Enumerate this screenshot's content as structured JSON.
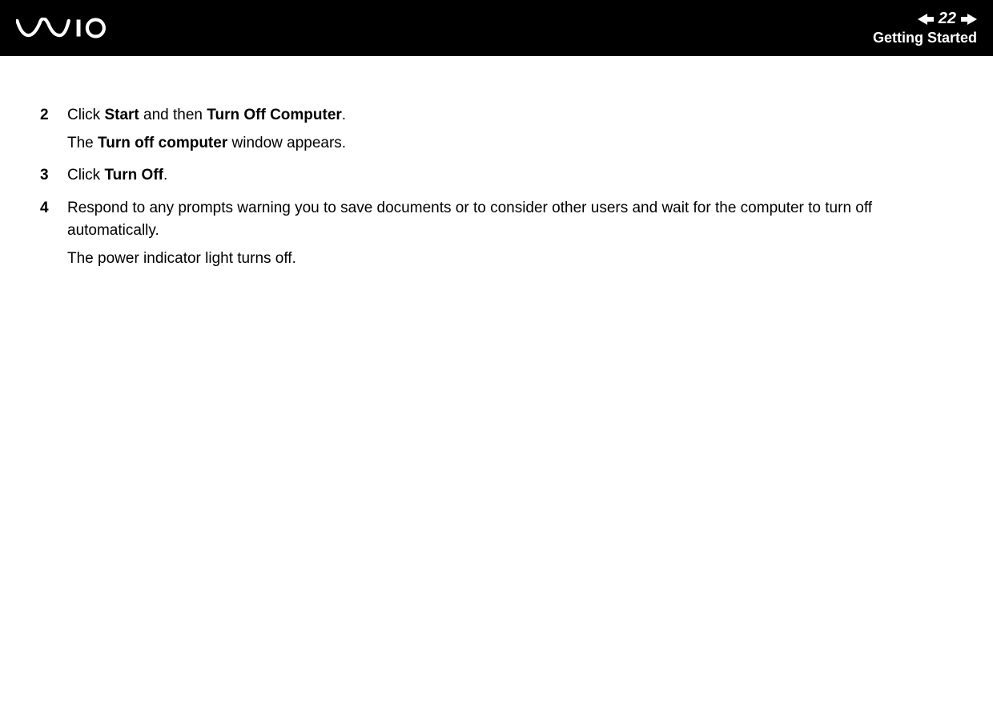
{
  "header": {
    "page_number": "22",
    "section_title": "Getting Started",
    "logo_name": "vaio"
  },
  "steps": [
    {
      "number": "2",
      "paragraphs": [
        {
          "runs": [
            {
              "t": "Click ",
              "b": false
            },
            {
              "t": "Start",
              "b": true
            },
            {
              "t": " and then ",
              "b": false
            },
            {
              "t": "Turn Off Computer",
              "b": true
            },
            {
              "t": ".",
              "b": false
            }
          ]
        },
        {
          "runs": [
            {
              "t": "The ",
              "b": false
            },
            {
              "t": "Turn off computer",
              "b": true
            },
            {
              "t": " window appears.",
              "b": false
            }
          ]
        }
      ]
    },
    {
      "number": "3",
      "paragraphs": [
        {
          "runs": [
            {
              "t": "Click ",
              "b": false
            },
            {
              "t": "Turn Off",
              "b": true
            },
            {
              "t": ".",
              "b": false
            }
          ]
        }
      ]
    },
    {
      "number": "4",
      "paragraphs": [
        {
          "runs": [
            {
              "t": "Respond to any prompts warning you to save documents or to consider other users and wait for the computer to turn off automatically.",
              "b": false
            }
          ]
        },
        {
          "runs": [
            {
              "t": "The power indicator light turns off.",
              "b": false
            }
          ]
        }
      ]
    }
  ]
}
